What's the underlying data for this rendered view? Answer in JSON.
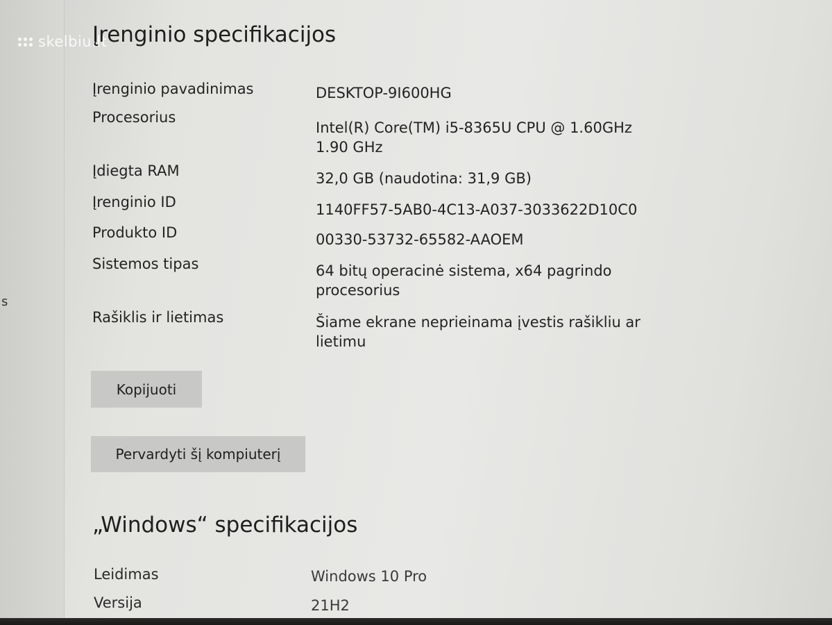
{
  "watermark": {
    "text": "skelbiu.lt"
  },
  "left_pane": {
    "partial_text": "s"
  },
  "device_specs": {
    "title": "Įrenginio specifikacijos",
    "rows": [
      {
        "label": "Įrenginio pavadinimas",
        "value": "DESKTOP-9I600HG"
      },
      {
        "label": "Procesorius",
        "value": "Intel(R) Core(TM) i5-8365U CPU @ 1.60GHz 1.90 GHz"
      },
      {
        "label": "Įdiegta RAM",
        "value": "32,0 GB (naudotina: 31,9 GB)"
      },
      {
        "label": "Įrenginio ID",
        "value": "1140FF57-5AB0-4C13-A037-3033622D10C0"
      },
      {
        "label": "Produkto ID",
        "value": "00330-53732-65582-AAOEM"
      },
      {
        "label": "Sistemos tipas",
        "value": "64 bitų operacinė sistema, x64 pagrindo procesorius"
      },
      {
        "label": "Rašiklis ir lietimas",
        "value": "Šiame ekrane neprieinama įvestis rašikliu ar lietimu"
      }
    ],
    "copy_button": "Kopijuoti",
    "rename_button": "Pervardyti šį kompiuterį"
  },
  "windows_specs": {
    "title": "„Windows“ specifikacijos",
    "rows": [
      {
        "label": "Leidimas",
        "value": "Windows 10 Pro"
      },
      {
        "label": "Versija",
        "value": "21H2"
      }
    ]
  }
}
